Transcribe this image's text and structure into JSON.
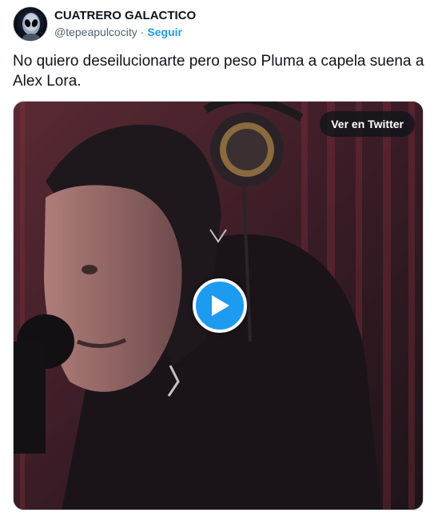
{
  "author": {
    "display_name": "CUATRERO GALACTICO",
    "handle": "@tepeapulcocity",
    "separator": "·",
    "follow_label": "Seguir"
  },
  "tweet": {
    "text": "No quiero deseilucionarte pero peso Pluma a capela suena a Alex Lora."
  },
  "media": {
    "watch_label": "Ver en Twitter"
  },
  "colors": {
    "accent": "#1d9bf0",
    "text": "#0f1419",
    "secondary_text": "#536471"
  },
  "icons": [
    "alien-avatar-icon",
    "play-icon"
  ]
}
